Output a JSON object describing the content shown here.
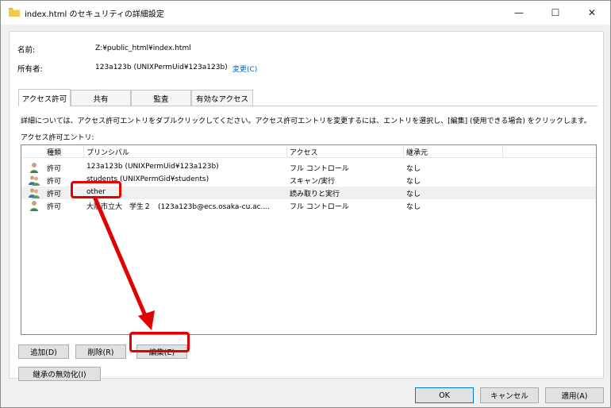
{
  "window": {
    "title": "index.html のセキュリティの詳細設定",
    "minimize_glyph": "—",
    "maximize_glyph": "☐",
    "close_glyph": "✕"
  },
  "props": {
    "name_label": "名前:",
    "name_value": "Z:¥public_html¥index.html",
    "owner_label": "所有者:",
    "owner_value": "123a123b (UNIXPermUid¥123a123b)",
    "change_link": "変更(C)"
  },
  "tabs": [
    {
      "label": "アクセス許可",
      "active": true
    },
    {
      "label": "共有",
      "active": false
    },
    {
      "label": "監査",
      "active": false
    },
    {
      "label": "有効なアクセス",
      "active": false
    }
  ],
  "info_text": "詳細については、アクセス許可エントリをダブルクリックしてください。アクセス許可エントリを変更するには、エントリを選択し、[編集] (使用できる場合) をクリックします。",
  "entries_label": "アクセス許可エントリ:",
  "table": {
    "columns": [
      "種類",
      "プリンシパル",
      "アクセス",
      "継承元"
    ],
    "rows": [
      {
        "icon": "single-user-icon",
        "type": "許可",
        "principal": "123a123b (UNIXPermUid¥123a123b)",
        "access": "フル コントロール",
        "inherited": "なし"
      },
      {
        "icon": "group-users-icon",
        "type": "許可",
        "principal": "students (UNIXPermGid¥students)",
        "access": "スキャン/実行",
        "inherited": "なし"
      },
      {
        "icon": "group-users-icon",
        "type": "許可",
        "principal": "other",
        "access": "読み取りと実行",
        "inherited": "なし"
      },
      {
        "icon": "single-user-icon",
        "type": "許可",
        "principal": "大阪市立大　学生２　(123a123b@ecs.osaka-cu.ac....",
        "access": "フル コントロール",
        "inherited": "なし"
      }
    ]
  },
  "buttons": {
    "add": "追加(D)",
    "remove": "削除(R)",
    "edit": "編集(E)",
    "disable_inheritance": "継承の無効化(I)",
    "ok": "OK",
    "cancel": "キャンセル",
    "apply": "適用(A)"
  },
  "colors": {
    "highlight": "#e30000",
    "link": "#0066cc",
    "accent": "#0078d7"
  }
}
